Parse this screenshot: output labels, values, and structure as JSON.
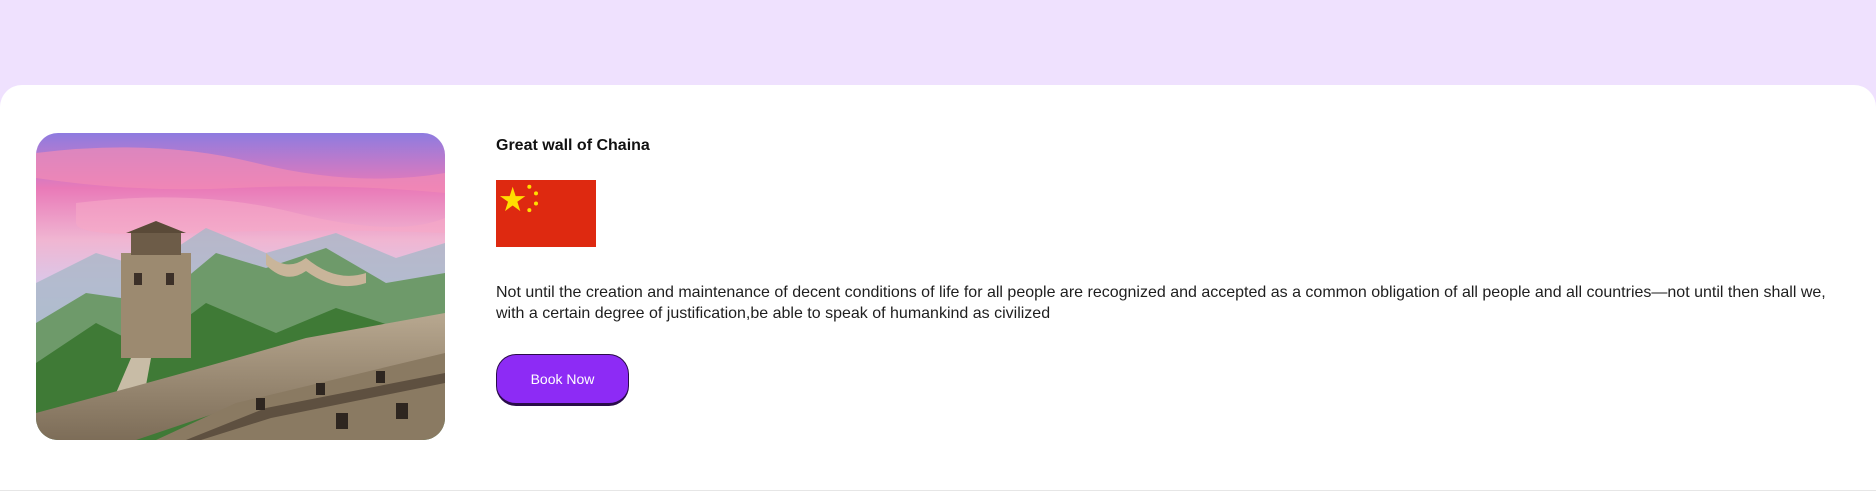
{
  "destination": {
    "title": "Great wall of Chaina",
    "image_icon": "great-wall-photo",
    "flag_icon": "china-flag",
    "description": "Not until the creation and maintenance of decent conditions of life for all people are recognized and accepted as a common obligation of all people and all countries—not until then shall we, with a certain degree of justification,be able to speak of humankind as civilized",
    "button_label": "Book Now"
  },
  "colors": {
    "page_background": "#efe1fe",
    "card_background": "#ffffff",
    "button": "#8d2bf5",
    "flag_red": "#de2910",
    "flag_star": "#ffde00"
  }
}
